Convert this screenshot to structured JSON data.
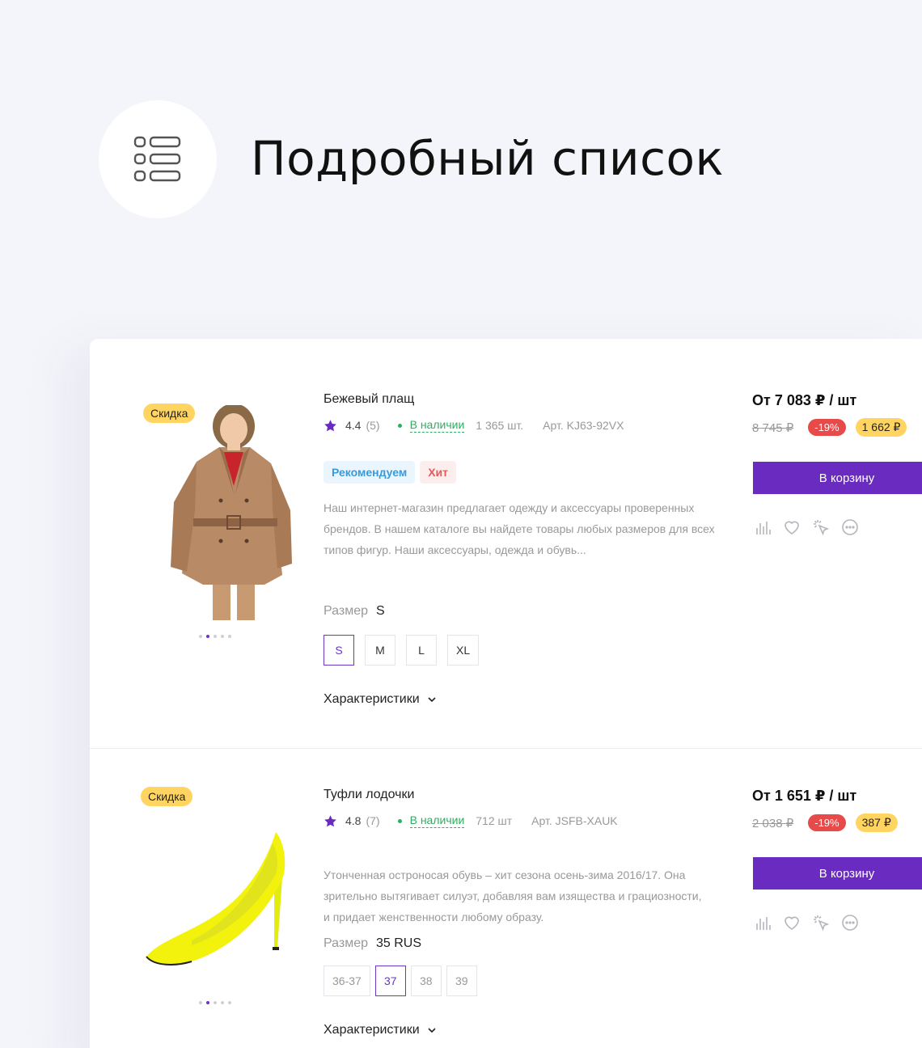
{
  "header": {
    "title": "Подробный список",
    "icon": "detailed-list-icon"
  },
  "colors": {
    "accent": "#6a2cc0",
    "sale_badge": "#ffd460",
    "discount": "#e84a4a",
    "in_stock": "#2fae60"
  },
  "products": [
    {
      "badge": "Скидка",
      "name": "Бежевый плащ",
      "rating": "4.4",
      "votes": "(5)",
      "stock": "В наличии",
      "quantity": "1 365 шт.",
      "article": "Арт. KJ63-92VX",
      "tags": [
        "Рекомендуем",
        "Хит"
      ],
      "description": "Наш интернет-магазин предлагает одежду и аксессуары проверенных брендов. В нашем каталоге вы найдете товары любых размеров для всех типов фигур. Наши аксессуары, одежда и обувь...",
      "size_label": "Размер",
      "size_value": "S",
      "sizes": [
        "S",
        "M",
        "L",
        "XL"
      ],
      "selected_size": "S",
      "characteristics": "Характеристики",
      "price": "От 7 083 ₽ / шт",
      "old_price": "8 745 ₽",
      "discount": "-19%",
      "savings": "1 662 ₽",
      "cart_button": "В корзину",
      "image_dots": 5,
      "image_active_dot": 2
    },
    {
      "badge": "Скидка",
      "name": "Туфли лодочки",
      "rating": "4.8",
      "votes": "(7)",
      "stock": "В наличии",
      "quantity": "712 шт",
      "article": "Арт. JSFB-XAUK",
      "description": "Утонченная остроносая обувь – хит сезона осень-зима 2016/17. Она зрительно вытягивает силуэт, добавляя вам изящества и грациозности, и придает женственности любому образу.",
      "size_label": "Размер",
      "size_value": "35 RUS",
      "sizes": [
        "36-37",
        "37",
        "38",
        "39"
      ],
      "selected_size": "37",
      "characteristics": "Характеристики",
      "price": "От 1 651 ₽ / шт",
      "old_price": "2 038 ₽",
      "discount": "-19%",
      "savings": "387 ₽",
      "cart_button": "В корзину",
      "image_dots": 5,
      "image_active_dot": 2
    }
  ]
}
